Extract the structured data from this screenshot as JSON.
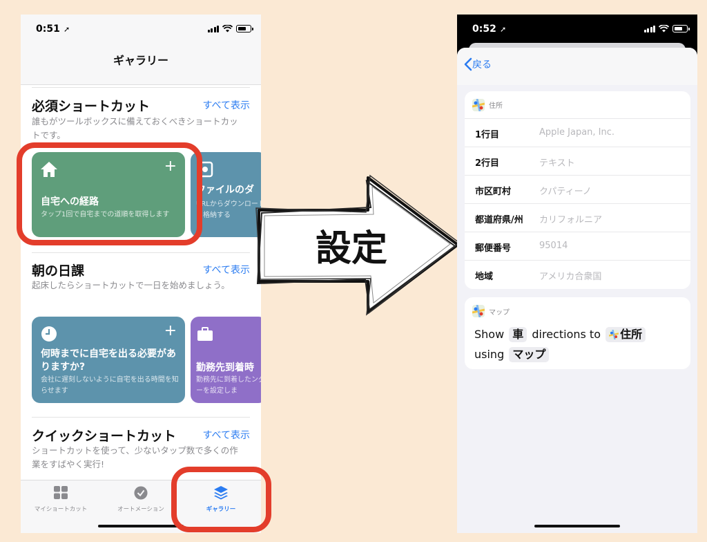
{
  "left": {
    "time": "0:51",
    "nav_title": "ギャラリー",
    "sections": [
      {
        "title": "必須ショートカット",
        "see_all": "すべて表示",
        "desc": "誰もがツールボックスに備えておくべきショートカットです。",
        "cards": [
          {
            "title": "自宅への経路",
            "desc": "タップ1回で自宅までの道順を取得します",
            "color": "#5f9e7b",
            "icon": "house-icon"
          },
          {
            "title": "ファイルのダ",
            "desc": "URLからダウンロードに格納する",
            "color": "#5d93ac",
            "icon": "download-icon"
          }
        ]
      },
      {
        "title": "朝の日課",
        "see_all": "すべて表示",
        "desc": "起床したらショートカットで一日を始めましょう。",
        "cards": [
          {
            "title": "何時までに自宅を出る必要がありますか?",
            "desc": "会社に遅刻しないように自宅を出る時間を知らせます",
            "color": "#5d93ac",
            "icon": "clock-icon"
          },
          {
            "title": "勤務先到着時",
            "desc": "勤務先に到着したンダーを設定しま",
            "color": "#8f6fc8",
            "icon": "briefcase-icon"
          }
        ]
      },
      {
        "title": "クイックショートカット",
        "see_all": "すべて表示",
        "desc": "ショートカットを使って、少ないタップ数で多くの作業をすばやく実行!"
      }
    ],
    "plus": "+",
    "tabs": [
      {
        "label": "マイショートカット",
        "icon": "grid-icon"
      },
      {
        "label": "オートメーション",
        "icon": "check-circle-icon"
      },
      {
        "label": "ギャラリー",
        "icon": "layers-icon",
        "active": true
      }
    ],
    "highlight_color": "#e33d2b"
  },
  "arrow_label": "設定",
  "right": {
    "time": "0:52",
    "back": "戻る",
    "address": {
      "header": "住所",
      "rows": [
        {
          "label": "1行目",
          "value": "Apple Japan, Inc."
        },
        {
          "label": "2行目",
          "value": "テキスト"
        },
        {
          "label": "市区町村",
          "value": "クパティーノ"
        },
        {
          "label": "都道府県/州",
          "value": "カリフォルニア"
        },
        {
          "label": "郵便番号",
          "value": "95014"
        },
        {
          "label": "地域",
          "value": "アメリカ合衆国"
        }
      ]
    },
    "maps": {
      "header": "マップ",
      "show": "Show",
      "mode": "車",
      "directions_to": "directions to",
      "dest": "住所",
      "using": "using",
      "app": "マップ"
    }
  },
  "colors": {
    "background": "#fbe9d4",
    "accent": "#2b7cf1"
  }
}
